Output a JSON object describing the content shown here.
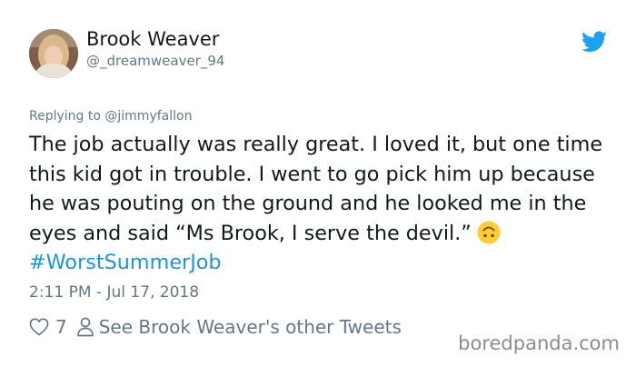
{
  "user": {
    "display_name": "Brook Weaver",
    "handle": "@_dreamweaver_94"
  },
  "icons": {
    "brand": "twitter-bird-icon",
    "like": "heart-outline-icon",
    "profile": "person-outline-icon",
    "emoji": "upside-down-face-emoji"
  },
  "colors": {
    "twitter_blue": "#1da1f2",
    "hashtag": "#1b95e0",
    "text": "#14171a",
    "muted": "#657786",
    "emoji": "#ffcc33"
  },
  "tweet": {
    "replying_prefix": "Replying to ",
    "replying_to": "@jimmyfallon",
    "text_main": "The job actually was really great. I loved it, but one time this kid got in trouble. I went to go pick him up because he was pouting on the ground and he looked me in the eyes and said “Ms Brook, I serve the devil.”",
    "hashtag": "#WorstSummerJob",
    "timestamp": "2:11 PM - Jul 17, 2018"
  },
  "actions": {
    "like_count": "7",
    "other_tweets_label": "See Brook Weaver's other Tweets"
  },
  "watermark": "boredpanda.com"
}
